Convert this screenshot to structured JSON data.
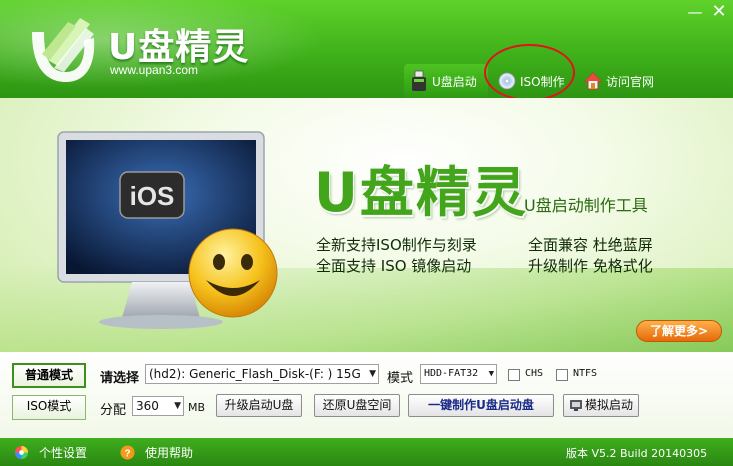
{
  "window": {
    "minimize_glyph": "—",
    "close_glyph": "✕"
  },
  "header": {
    "brand_title": "U盘精灵",
    "brand_url": "www.upan3.com",
    "logo_icon": "u-leaf-logo-icon"
  },
  "nav": [
    {
      "label": "U盘启动",
      "icon": "usb-drive-icon"
    },
    {
      "label": "ISO制作",
      "icon": "cd-disc-icon"
    },
    {
      "label": "访问官网",
      "icon": "home-icon"
    }
  ],
  "banner": {
    "title": "U盘精灵",
    "subtitle": "U盘启动制作工具",
    "screen_text": "iOS",
    "features": [
      "全新支持ISO制作与刻录",
      "全面支持 ISO 镜像启动",
      "全面兼容  杜绝蓝屏",
      "升级制作  免格式化"
    ],
    "more_label": "了解更多>"
  },
  "controls": {
    "mode_normal": "普通模式",
    "mode_iso": "ISO模式",
    "select_label": "请选择",
    "disk_value": "(hd2): Generic_Flash_Disk-(F: ) 15G",
    "mode_label": "模式",
    "mode_value": "HDD-FAT32",
    "chs_label": "CHS",
    "ntfs_label": "NTFS",
    "partition_label": "分配",
    "partition_value": "360",
    "partition_unit": "MB",
    "upgrade_label": "升级启动U盘",
    "restore_label": "还原U盘空间",
    "oneclick_label": "一键制作U盘启动盘",
    "simulate_label": "模拟启动"
  },
  "footer": {
    "personal_label": "个性设置",
    "help_label": "使用帮助",
    "version": "版本 V5.2 Build 20140305"
  },
  "colors": {
    "accent_green": "#3fb11a",
    "highlight_red": "#e0141c",
    "more_orange": "#f08a20"
  }
}
